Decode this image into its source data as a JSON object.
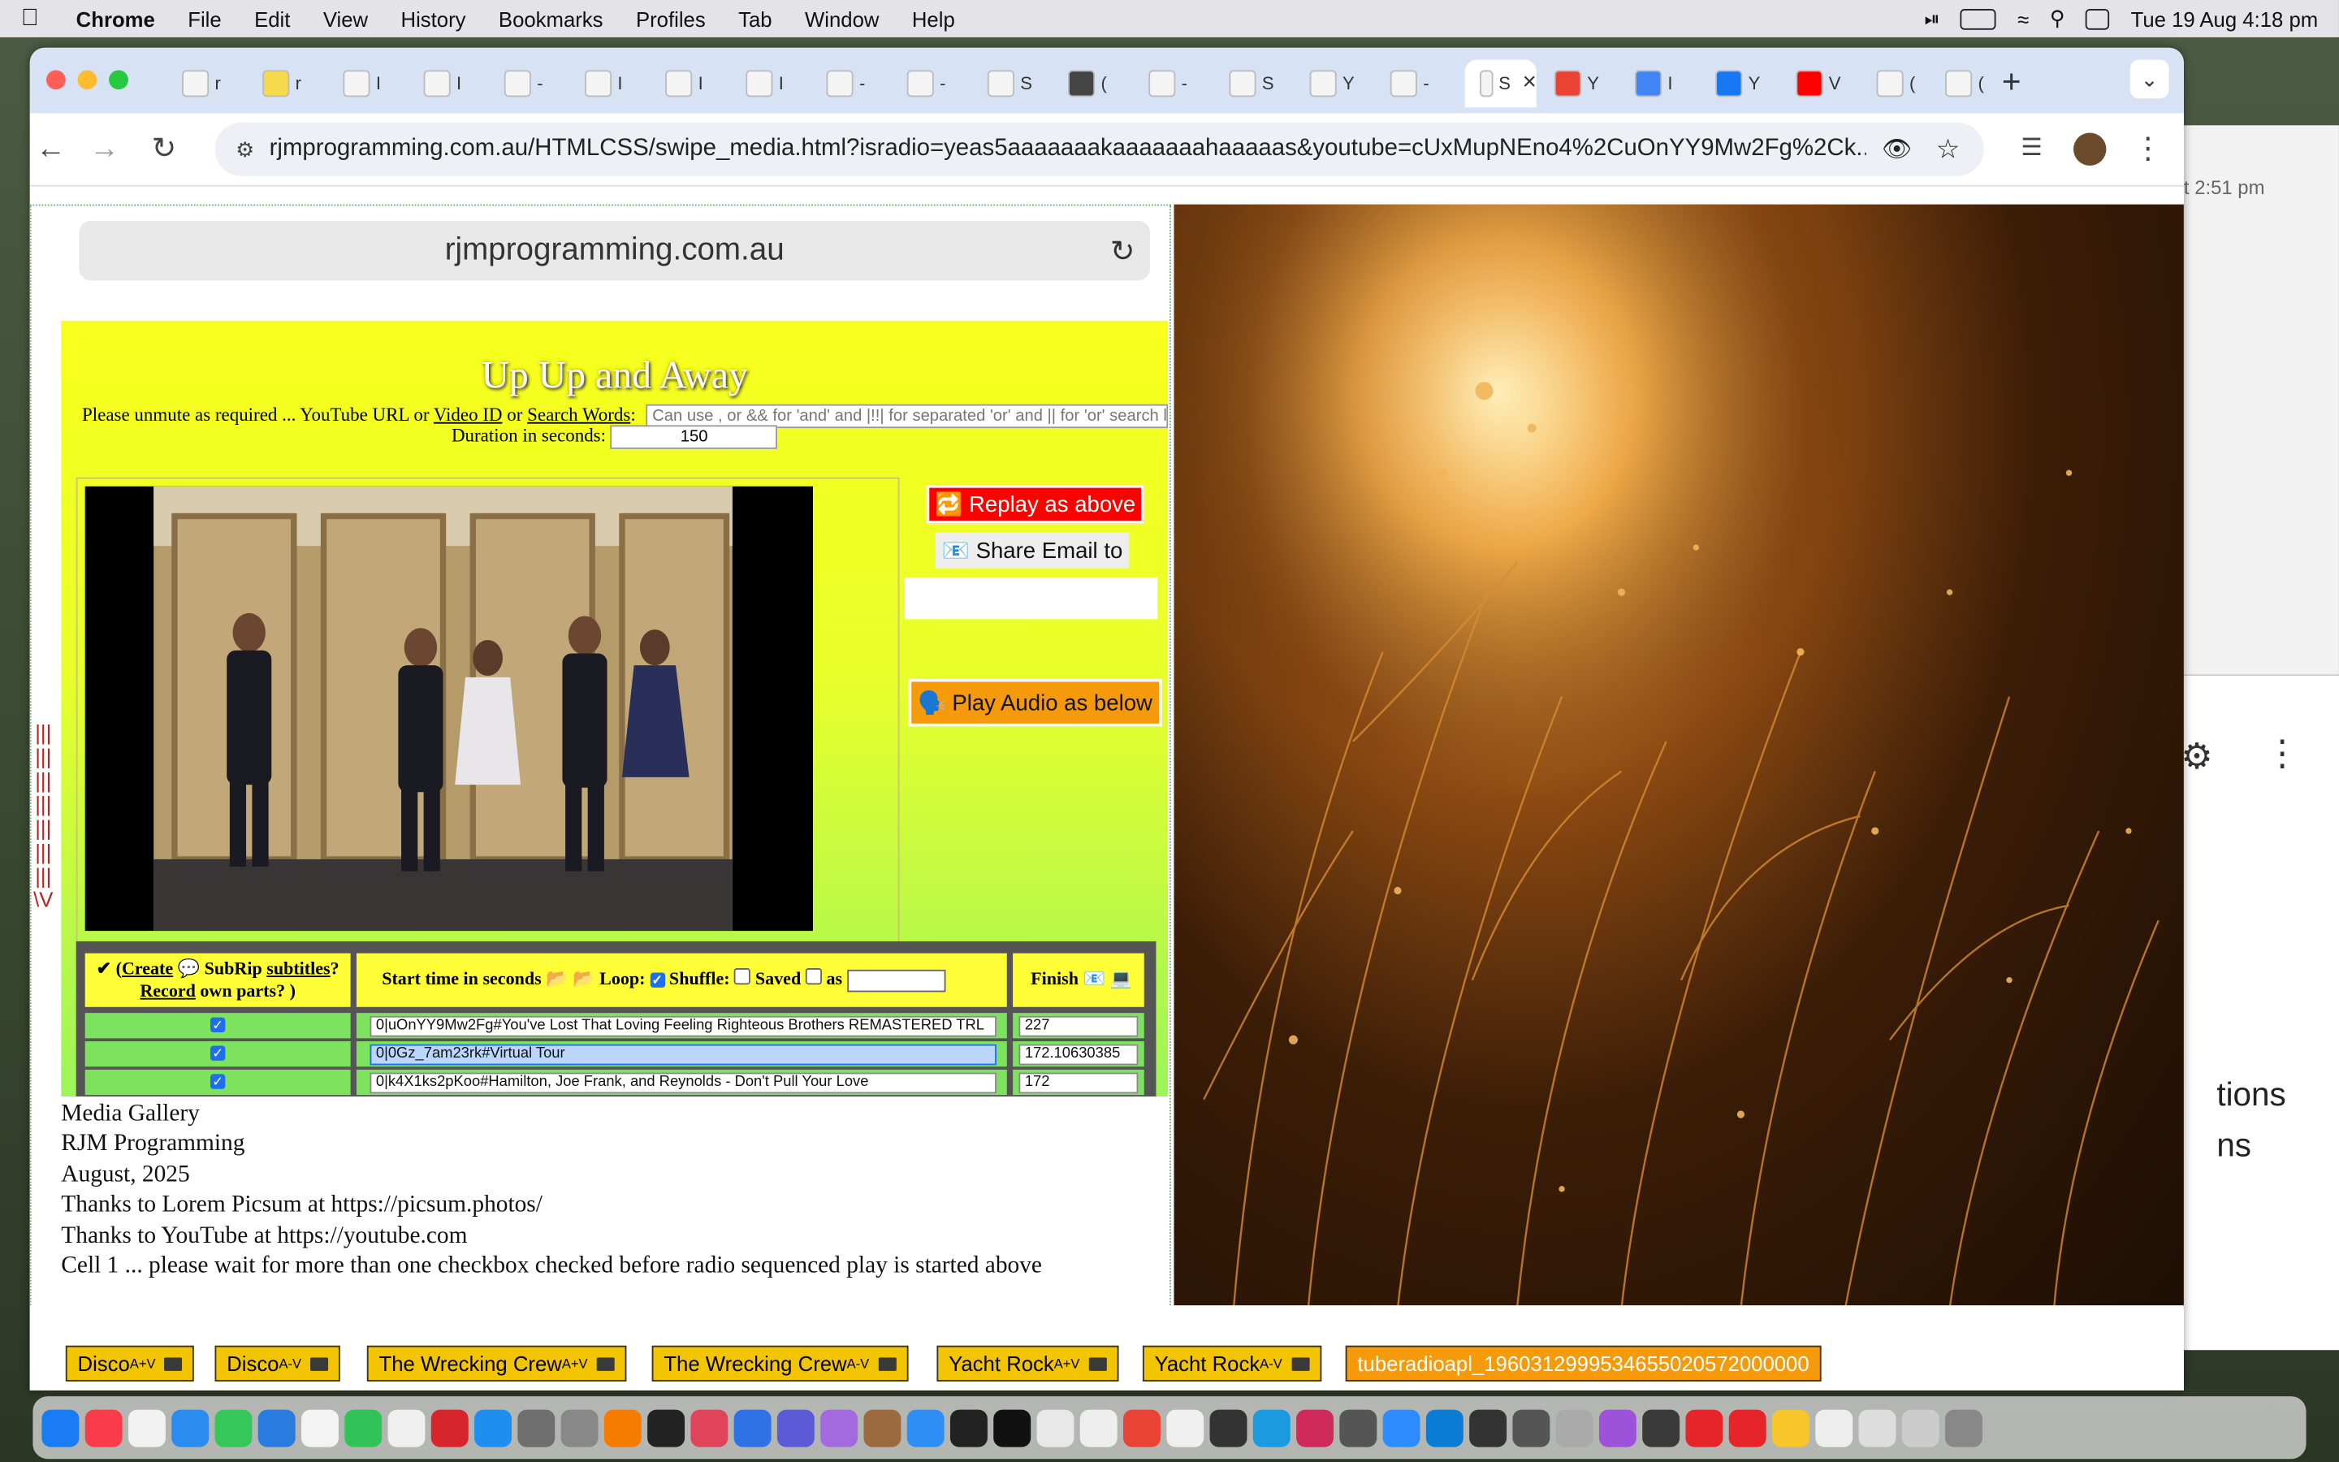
{
  "menubar": {
    "app": "Chrome",
    "items": [
      "File",
      "Edit",
      "View",
      "History",
      "Bookmarks",
      "Profiles",
      "Tab",
      "Window",
      "Help"
    ],
    "datetime": "Tue 19 Aug  4:18 pm"
  },
  "browser": {
    "url": "rjmprogramming.com.au/HTMLCSS/swipe_media.html?isradio=yeas5aaaaaaakaaaaaaahaaaaas&youtube=cUxMupNEno4%2CuOnYY9Mw2Fg%2Ck...",
    "tab_labels": [
      "r",
      "r",
      "I",
      "I",
      "-",
      "I",
      "I",
      "I",
      "-",
      "-",
      "S",
      "(",
      "-",
      "S",
      "Y",
      "-",
      "S",
      "Y",
      "I",
      "Y",
      "V",
      "(",
      "("
    ],
    "active_tab": "S"
  },
  "background_window": {
    "time_text": "t 2:51 pm",
    "text1": "tions",
    "text2": "ns"
  },
  "page": {
    "inner_address": "rjmprogramming.com.au",
    "title": "Up Up and Away",
    "url_prompt": "Please unmute as required ... YouTube URL or ",
    "video_id_link": "Video ID",
    "or_text": " or ",
    "search_words_link": "Search Words",
    "colon": ":",
    "search_placeholder": "Can use , or && for 'and' and |!!| for separated 'or' and || for 'or' search logics",
    "duration_label": "Duration in seconds: ",
    "duration_value": "150",
    "replay_button": "🔁 Replay as above",
    "share_button": "📧 Share Email to",
    "audio_button": "🗣️ Play Audio as below",
    "table": {
      "header_col1_pre": "✔ (",
      "create_link": "Create",
      "subrip_text": " 💬 SubRip ",
      "subtitles_link": "subtitles",
      "q_text": "?",
      "record_link": "Record",
      "own_parts_text": " own parts?       )",
      "header_col2": "Start time in seconds",
      "loop_label": "Loop:",
      "shuffle_label": "Shuffle:",
      "saved_label": "Saved",
      "as_label": "as",
      "header_col3": "Finish",
      "rows": [
        {
          "checked": "✓",
          "value": "0|uOnYY9Mw2Fg#You've Lost That Loving Feeling Righteous Brothers REMASTERED TRL",
          "finish": "227"
        },
        {
          "checked": "✓",
          "value": "0|0Gz_7am23rk#Virtual Tour",
          "finish": "172.10630385"
        },
        {
          "checked": "✓",
          "value": "0|k4X1ks2pKoo#Hamilton, Joe Frank, and Reynolds - Don't Pull Your Love",
          "finish": "172"
        }
      ]
    },
    "footer_lines": [
      "Media Gallery",
      "RJM Programming",
      "August, 2025",
      "Thanks to Lorem Picsum at https://picsum.photos/",
      "Thanks to YouTube at https://youtube.com",
      "Cell 1 ... please wait for more than one checkbox checked before radio sequenced play is started above"
    ],
    "vertical_bar_text": "|||||||||||||||||||||\\V"
  },
  "chips": [
    {
      "label": "Disco",
      "sup": "A+V",
      "sub": ""
    },
    {
      "label": "Disco",
      "sup": "",
      "sub": "A-V"
    },
    {
      "label": "The Wrecking Crew",
      "sup": "A+V",
      "sub": ""
    },
    {
      "label": "The Wrecking Crew",
      "sup": "",
      "sub": "A-V"
    },
    {
      "label": "Yacht Rock",
      "sup": "A+V",
      "sub": ""
    },
    {
      "label": "Yacht Rock",
      "sup": "",
      "sub": "A-V"
    }
  ],
  "radio_chip": "tuberadioapl_1960312999534655020572000000",
  "colors": {
    "tabstrip": "#d7e3f4",
    "panel_yellow": "#f8ff1c",
    "panel_green": "#9cf55a",
    "replay_red": "#ff0000",
    "audio_orange": "#f59a0b",
    "chip_yellow": "#f3c400"
  }
}
